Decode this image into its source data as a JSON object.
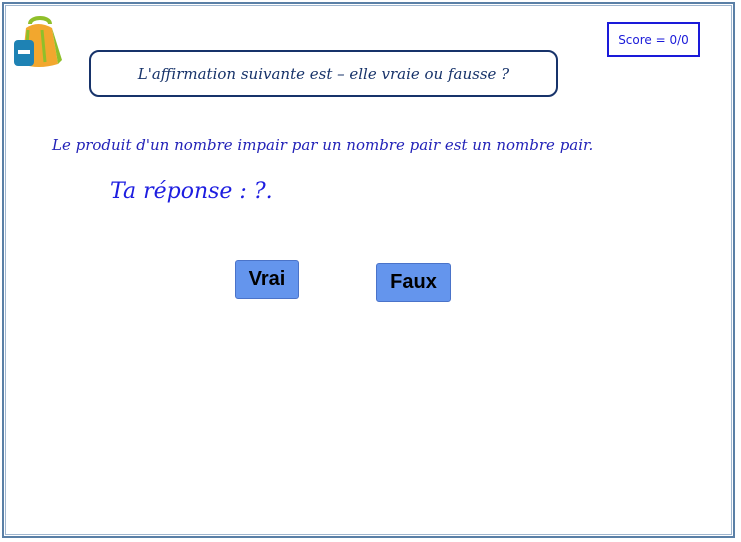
{
  "score": {
    "label": "Score = 0/0"
  },
  "prompt": {
    "text": "L'affirmation suivante est – elle vraie ou fausse ?"
  },
  "statement": {
    "text": "Le produit d'un nombre impair par un nombre pair est un nombre pair."
  },
  "answer": {
    "text": "Ta réponse : ?."
  },
  "buttons": {
    "vrai": "Vrai",
    "faux": "Faux"
  },
  "icons": {
    "logo": "backpack-icon"
  },
  "colors": {
    "button": "#6495ed",
    "text_blue": "#1d1de0",
    "prompt_border": "#17336a",
    "score_border": "#1a1ad9",
    "frame_border": "#5a7fa6"
  }
}
